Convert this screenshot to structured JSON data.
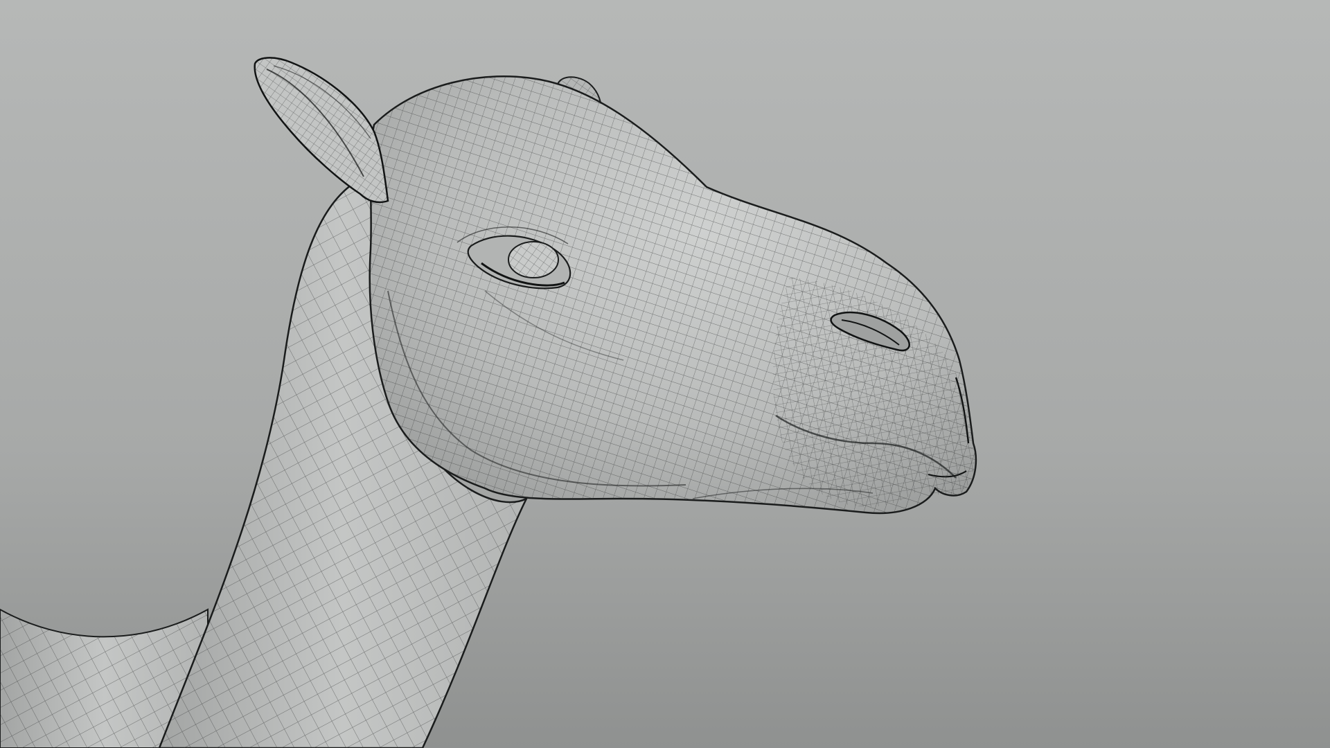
{
  "scene": {
    "subject": "camel-head-wireframe-mesh",
    "view": "side-profile",
    "shading": "wireframe-on-shaded"
  },
  "colors": {
    "background_light": "#b6b8b7",
    "background_mid": "#a7a9a8",
    "background_dark": "#8f9190",
    "mesh_fill_light": "#cfd1d0",
    "mesh_fill_mid": "#b9bbba",
    "mesh_fill_dark": "#9a9c9b",
    "wire": "#2a2c2c",
    "crease": "#1a1c1c"
  },
  "icons": []
}
